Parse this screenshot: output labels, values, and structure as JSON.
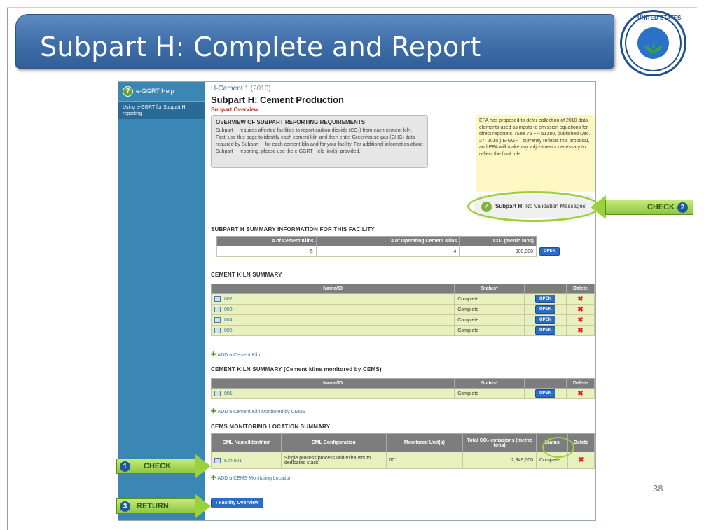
{
  "slide": {
    "title": "Subpart H: Complete and Report",
    "page_number": "38",
    "seal": {
      "top_text": "UNITED STATES",
      "left_text": "ENVIRONMENTAL",
      "right_text": "PROTECTION AGENCY"
    }
  },
  "sidebar": {
    "help_label": "e-GGRT Help",
    "link_label": "Using e-GGRT for Subpart H reporting"
  },
  "header": {
    "facility": "H-Cement 1",
    "year": "(2010)",
    "subpart_title": "Subpart H: Cement Production",
    "subpart_overview": "Subpart Overview"
  },
  "overview": {
    "heading": "OVERVIEW OF SUBPART REPORTING REQUIREMENTS",
    "body": "Subpart H requires affected facilities to report carbon dioxide (CO₂) from each cement kiln. First, use this page to identify each cement kiln and then enter Greenhouse gas (GHG) data required by Subpart H for each cement kiln and for your facility. For additional information about Subpart H reporting, please use the e-GGRT Help link(s) provided."
  },
  "note": "EPA has proposed to defer collection of 2010 data elements used as inputs to emission equations for direct reporters. (See 76 FR 51380, published Dec. 27, 2010.) E-GGRT currently reflects this proposal, and EPA will make any adjustments necessary to reflect the final rule.",
  "validation": {
    "label": "Subpart H:",
    "message": "No Validation Messages"
  },
  "summary": {
    "heading": "SUBPART H SUMMARY INFORMATION FOR THIS FACILITY",
    "col1": "# of Cement Kilns",
    "col2": "# of Operating Cement Kilns",
    "col3": "CO₂ (metric tons)",
    "val1": "5",
    "val2": "4",
    "val3": "900,000",
    "open": "OPEN"
  },
  "kiln_summary": {
    "heading": "CEMENT KILN SUMMARY",
    "col_name": "Name/ID",
    "col_status": "Status*",
    "col_delete": "Delete",
    "rows": [
      {
        "name": "002",
        "status": "Complete",
        "open": "OPEN"
      },
      {
        "name": "003",
        "status": "Complete",
        "open": "OPEN"
      },
      {
        "name": "004",
        "status": "Complete",
        "open": "OPEN"
      },
      {
        "name": "005",
        "status": "Complete",
        "open": "OPEN"
      }
    ],
    "add_label": "ADD a Cement Kiln"
  },
  "cems_kiln_summary": {
    "heading": "CEMENT KILN SUMMARY (Cement kilns monitored by CEMS)",
    "col_name": "Name/ID",
    "col_status": "Status*",
    "col_delete": "Delete",
    "rows": [
      {
        "name": "001",
        "status": "Complete",
        "open": "OPEN"
      }
    ],
    "add_label": "ADD a Cement Kiln Monitored by CEMS"
  },
  "cml_summary": {
    "heading": "CEMS MONITORING LOCATION SUMMARY",
    "col1": "CML Name/Identifier",
    "col2": "CML Configuration",
    "col3": "Monitored Unit(s)",
    "col4": "Total CO₂ emissions (metric tons)",
    "col5": "Status",
    "col6": "Delete",
    "row": {
      "name": "Kiln 001",
      "config": "Single process/process unit exhausts to dedicated stack",
      "units": "001",
      "total": "2,349,000",
      "status": "Complete"
    },
    "add_label": "ADD a CEMS Monitoring Location"
  },
  "facility_overview_button": "Facility Overview",
  "callouts": {
    "check1": {
      "num": "1",
      "label": "CHECK"
    },
    "check2": {
      "num": "2",
      "label": "CHECK"
    },
    "return3": {
      "num": "3",
      "label": "RETURN"
    }
  },
  "colors": {
    "title_bar": "#3f6ea8",
    "sidebar": "#3a86b4",
    "callout_green": "#9bd13a",
    "open_button": "#2b6cc4",
    "row_green": "#e8f0be"
  }
}
